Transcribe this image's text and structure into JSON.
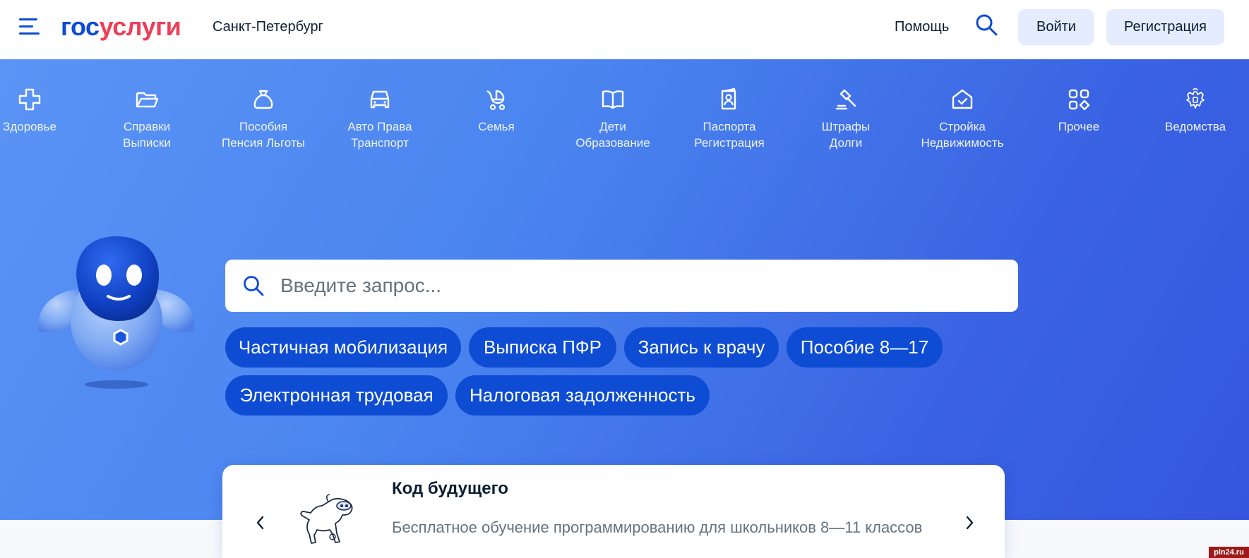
{
  "header": {
    "logo_part1": "гос",
    "logo_part2": "услуги",
    "city": "Санкт-Петербург",
    "help": "Помощь",
    "login": "Войти",
    "register": "Регистрация"
  },
  "categories": [
    {
      "label": "Здоровье",
      "icon": "plus-cross-icon"
    },
    {
      "label": "Справки\nВыписки",
      "icon": "folder-icon"
    },
    {
      "label": "Пособия\nПенсия Льготы",
      "icon": "money-bag-icon"
    },
    {
      "label": "Авто Права\nТранспорт",
      "icon": "car-icon"
    },
    {
      "label": "Семья",
      "icon": "stroller-icon"
    },
    {
      "label": "Дети\nОбразование",
      "icon": "book-icon"
    },
    {
      "label": "Паспорта\nРегистрация",
      "icon": "passport-icon"
    },
    {
      "label": "Штрафы\nДолги",
      "icon": "gavel-icon"
    },
    {
      "label": "Стройка\nНедвижимость",
      "icon": "house-icon"
    },
    {
      "label": "Прочее",
      "icon": "grid-icon"
    },
    {
      "label": "Ведомства",
      "icon": "coat-of-arms-icon"
    }
  ],
  "search": {
    "placeholder": "Введите запрос..."
  },
  "chips": [
    "Частичная мобилизация",
    "Выписка ПФР",
    "Запись к врачу",
    "Пособие 8—17",
    "Электронная трудовая",
    "Налоговая задолженность"
  ],
  "promo": {
    "title": "Код будущего",
    "description": "Бесплатное обучение программированию для школьников 8—11 классов"
  },
  "watermark": "pln24.ru",
  "colors": {
    "brand_blue": "#0d4cd3",
    "brand_red": "#ee3f58",
    "hero_start": "#5b94f5",
    "hero_end": "#3456de"
  }
}
